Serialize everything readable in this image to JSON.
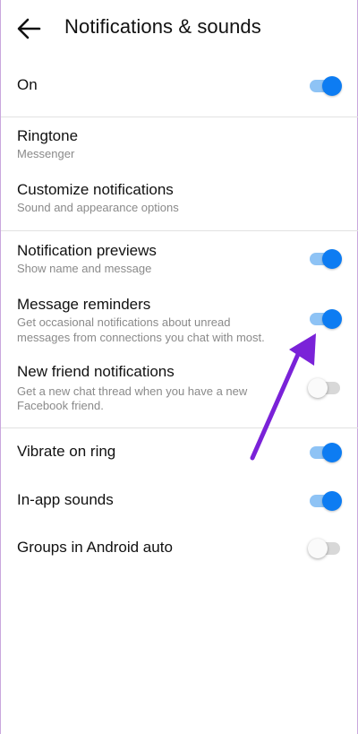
{
  "header": {
    "title": "Notifications & sounds",
    "back_icon": "arrow-left-icon"
  },
  "colors": {
    "toggle_on_knob": "#0d7cf2",
    "toggle_on_track": "#8ec3f5",
    "annotation_arrow": "#7a22d8"
  },
  "settings": {
    "on": {
      "label": "On",
      "enabled": true
    },
    "ringtone": {
      "label": "Ringtone",
      "sub": "Messenger"
    },
    "customize": {
      "label": "Customize notifications",
      "sub": "Sound and appearance options"
    },
    "previews": {
      "label": "Notification previews",
      "sub": "Show name and message",
      "enabled": true
    },
    "reminders": {
      "label": "Message reminders",
      "sub1": "Get occasional notifications about unread",
      "sub2": "messages from connections you chat with most.",
      "enabled": true
    },
    "friend": {
      "label": "New friend notifications",
      "sub1": "Get a new chat thread when you have a new",
      "sub2": "Facebook friend.",
      "enabled": false
    },
    "vibrate": {
      "label": "Vibrate on ring",
      "enabled": true
    },
    "inapp": {
      "label": "In-app sounds",
      "enabled": true
    },
    "android_auto": {
      "label": "Groups in Android auto",
      "enabled": false
    }
  }
}
